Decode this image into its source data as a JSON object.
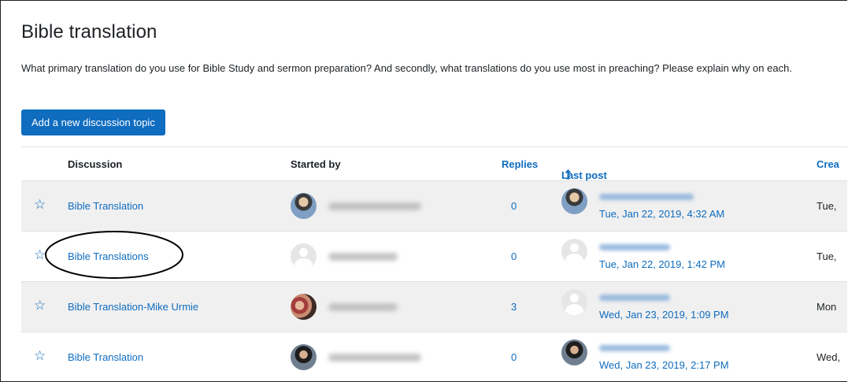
{
  "page": {
    "title": "Bible translation",
    "intro": "What primary translation do you use for Bible Study and sermon preparation?  And secondly, what translations do you use most in preaching?  Please explain why on each.",
    "add_button": "Add a new discussion topic"
  },
  "table": {
    "headers": {
      "discussion": "Discussion",
      "started_by": "Started by",
      "replies": "Replies",
      "last_post": "Last post",
      "created": "Crea"
    },
    "sort_indicator": "arrow-up-icon",
    "rows": [
      {
        "discussion": "Bible Translation",
        "replies": "0",
        "last_post": "Tue, Jan 22, 2019, 4:32 AM",
        "created": "Tue,",
        "starter_avatar": "photo",
        "last_avatar": "photo"
      },
      {
        "discussion": "Bible Translations",
        "replies": "0",
        "last_post": "Tue, Jan 22, 2019, 1:42 PM",
        "created": "Tue,",
        "starter_avatar": "default",
        "last_avatar": "default"
      },
      {
        "discussion": "Bible Translation-Mike Urmie",
        "replies": "3",
        "last_post": "Wed, Jan 23, 2019, 1:09 PM",
        "created": "Mon",
        "starter_avatar": "photo",
        "last_avatar": "default"
      },
      {
        "discussion": "Bible Translation",
        "replies": "0",
        "last_post": "Wed, Jan 23, 2019, 2:17 PM",
        "created": "Wed,",
        "starter_avatar": "photo",
        "last_avatar": "photo"
      }
    ]
  },
  "colors": {
    "accent": "#0f6cbf",
    "row_alt": "#f0f0f0"
  }
}
